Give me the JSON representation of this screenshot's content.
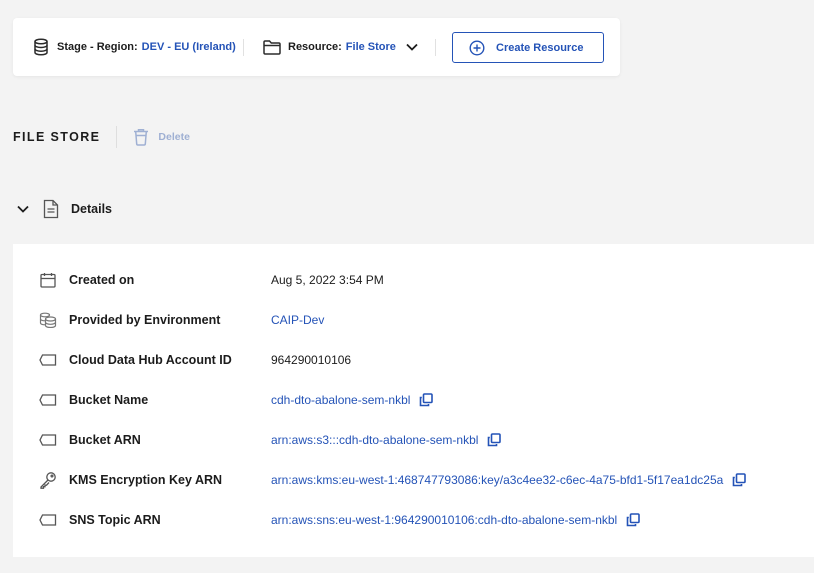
{
  "toolbar": {
    "stage_label": "Stage - Region:",
    "stage_value": "DEV - EU (Ireland)",
    "resource_label": "Resource:",
    "resource_value": "File Store",
    "create_label": "Create Resource"
  },
  "section": {
    "title": "FILE STORE",
    "delete_label": "Delete"
  },
  "details": {
    "title": "Details",
    "rows": [
      {
        "label": "Created on",
        "value": "Aug 5, 2022 3:54 PM",
        "icon": "calendar-icon"
      },
      {
        "label": "Provided by Environment",
        "value": "CAIP-Dev",
        "icon": "environment-icon"
      },
      {
        "label": "Cloud Data Hub Account ID",
        "value": "964290010106",
        "icon": "tag-icon"
      },
      {
        "label": "Bucket Name",
        "value": "cdh-dto-abalone-sem-nkbl",
        "icon": "tag-icon"
      },
      {
        "label": "Bucket ARN",
        "value": "arn:aws:s3:::cdh-dto-abalone-sem-nkbl",
        "icon": "tag-icon"
      },
      {
        "label": "KMS Encryption Key ARN",
        "value": "arn:aws:kms:eu-west-1:468747793086:key/a3c4ee32-c6ec-4a75-bfd1-5f17ea1dc25a",
        "icon": "key-icon"
      },
      {
        "label": "SNS Topic ARN",
        "value": "arn:aws:sns:eu-west-1:964290010106:cdh-dto-abalone-sem-nkbl",
        "icon": "tag-icon"
      }
    ]
  },
  "colors": {
    "accent": "#2453b7",
    "background": "#f3f3f3",
    "card": "#ffffff",
    "disabled": "#9fb0d3"
  }
}
